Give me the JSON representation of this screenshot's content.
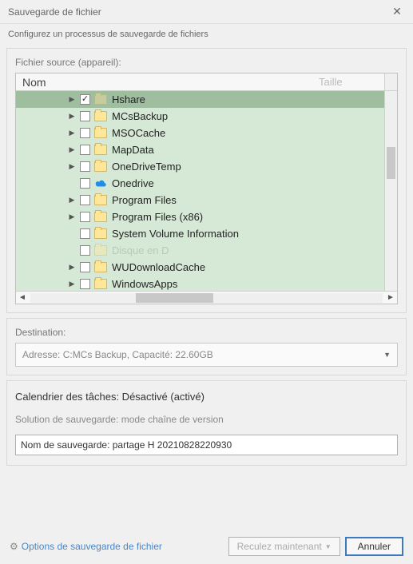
{
  "window": {
    "title": "Sauvegarde de fichier",
    "subtitle": "Configurez un processus de sauvegarde de fichiers"
  },
  "source": {
    "label": "Fichier source (appareil):",
    "columns": {
      "name": "Nom",
      "size": "Taille"
    },
    "rows": [
      {
        "label": "Hshare",
        "checked": true,
        "selected": true,
        "expander": true,
        "icon": "folder-dim"
      },
      {
        "label": "MCsBackup",
        "checked": false,
        "expander": true,
        "icon": "folder"
      },
      {
        "label": "MSOCache",
        "checked": false,
        "expander": true,
        "icon": "folder"
      },
      {
        "label": "MapData",
        "checked": false,
        "expander": true,
        "icon": "folder"
      },
      {
        "label": "OneDriveTemp",
        "checked": false,
        "expander": true,
        "icon": "folder"
      },
      {
        "label": "Onedrive",
        "checked": false,
        "expander": false,
        "icon": "cloud"
      },
      {
        "label": "Program Files",
        "checked": false,
        "expander": true,
        "icon": "folder"
      },
      {
        "label": "Program Files (x86)",
        "checked": false,
        "expander": true,
        "icon": "folder"
      },
      {
        "label": "System Volume Information",
        "checked": false,
        "expander": false,
        "icon": "folder"
      },
      {
        "label": "Disque en D",
        "checked": false,
        "expander": false,
        "icon": "folder-dim",
        "dim": true
      },
      {
        "label": "WUDownloadCache",
        "checked": false,
        "expander": true,
        "icon": "folder"
      },
      {
        "label": "WindowsApps",
        "checked": false,
        "expander": true,
        "icon": "folder"
      }
    ]
  },
  "destination": {
    "label": "Destination:",
    "value": "Adresse: C:MCs Backup, Capacité: 22.60GB"
  },
  "schedule": {
    "label": "Calendrier des tâches: Désactivé (activé)",
    "solution": "Solution de sauvegarde: mode chaîne de version",
    "name_value": "Nom de sauvegarde: partage H 20210828220930"
  },
  "footer": {
    "options": "Options de sauvegarde de fichier",
    "backup_now": "Reculez maintenant",
    "cancel": "Annuler"
  }
}
